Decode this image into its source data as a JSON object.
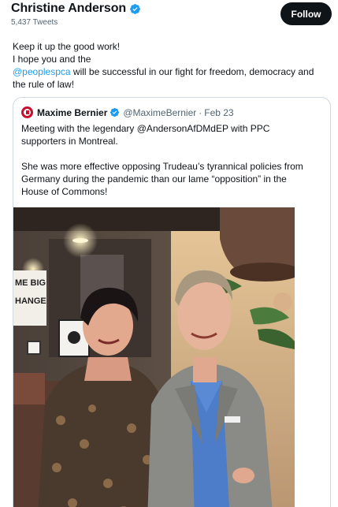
{
  "profile": {
    "name": "Christine Anderson",
    "tweet_count": "5,437 Tweets",
    "follow_label": "Follow"
  },
  "tweet": {
    "line1": "Keep it up the good work!",
    "line2": "I hope you and the",
    "mention": "@peoplespca",
    "line3_rest": " will be successful in our fight for freedom, democracy and",
    "line4": "the rule of law!"
  },
  "quote": {
    "name": "Maxime Bernier",
    "handle": "@MaximeBernier",
    "separator": "·",
    "date": "Feb 23",
    "lines": [
      "Meeting with the legendary @AndersonAfDMdEP with PPC",
      "supporters in Montreal.",
      "",
      "She was more effective opposing Trudeau’s tyrannical policies from",
      "Germany during the pandemic than our lame “opposition” in the",
      "House of Commons!"
    ],
    "photo_sign_text": [
      "ME BIG",
      "HANGE"
    ]
  },
  "colors": {
    "accent": "#1d9bf0",
    "text": "#0f1419",
    "muted": "#536471",
    "button": "#0f1419",
    "border": "#cfd9de"
  },
  "icons": {
    "verified": "verified-badge-icon",
    "avatar": "ppc-logo-avatar"
  }
}
